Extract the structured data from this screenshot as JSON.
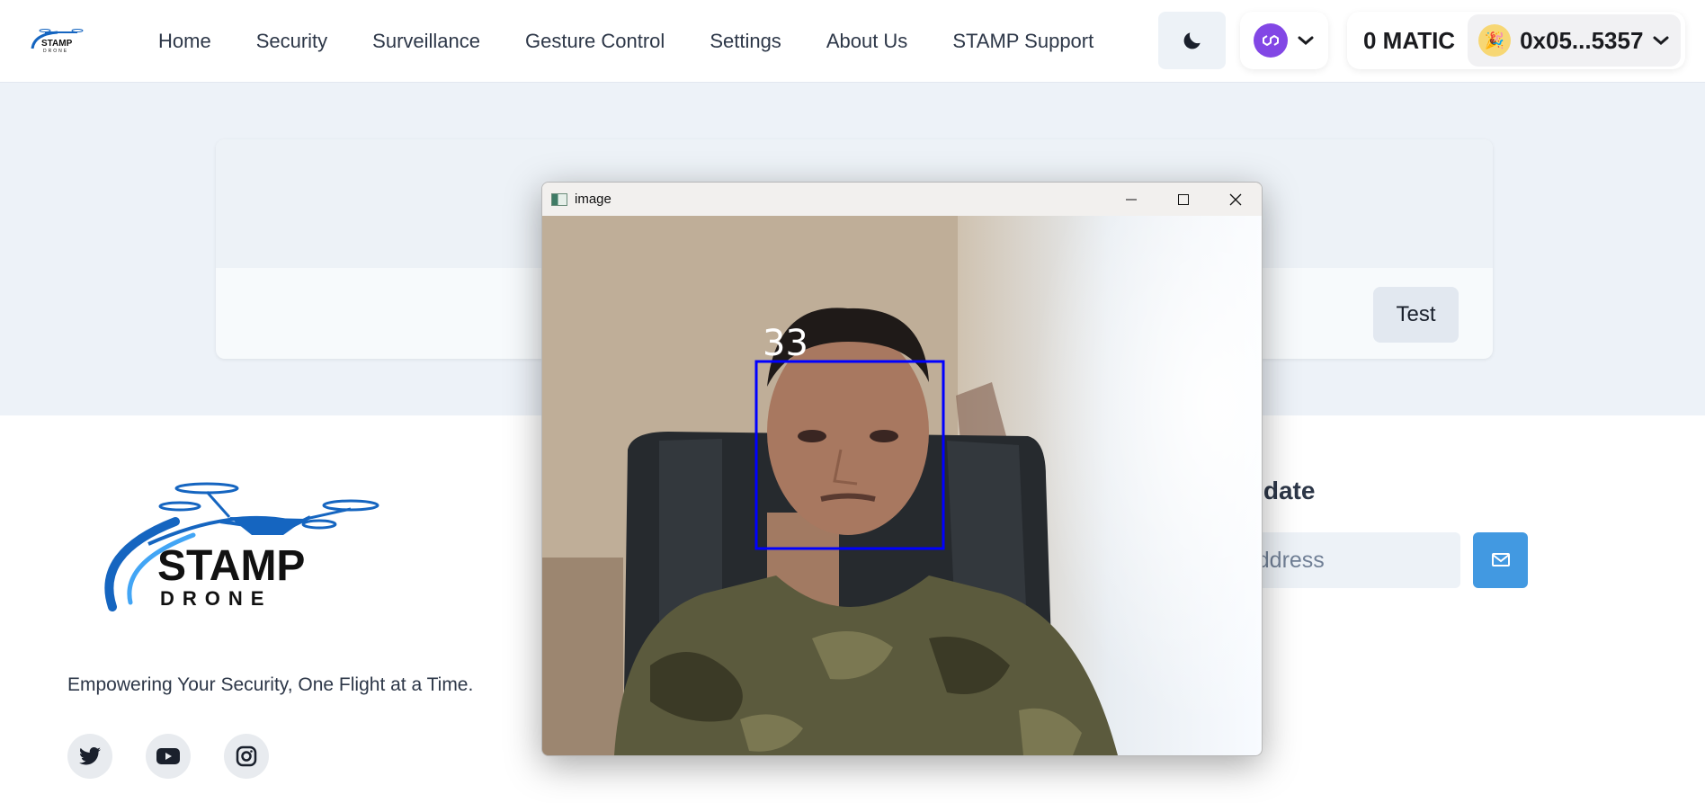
{
  "nav": {
    "links": [
      "Home",
      "Security",
      "Surveillance",
      "Gesture Control",
      "Settings",
      "About Us",
      "STAMP Support"
    ]
  },
  "wallet": {
    "balance": "0 MATIC",
    "address": "0x05...5357",
    "chain_icon": "polygon-icon",
    "chain_color": "#8247e5"
  },
  "hero": {
    "test_button": "Test"
  },
  "logo": {
    "line1": "STAMP",
    "line2": "DRONE"
  },
  "footer": {
    "tagline": "Empowering Your Security, One Flight at a Time.",
    "newsletter_title_visible": "o date",
    "email_placeholder_visible": "nail address",
    "social": [
      "twitter-icon",
      "youtube-icon",
      "instagram-icon"
    ]
  },
  "image_window": {
    "title": "image",
    "face_label": "33",
    "box_color": "#0000ff"
  },
  "colors": {
    "accent": "#4299e1",
    "hero_bg": "#edf2f8",
    "logo_blue": "#1565c0"
  }
}
